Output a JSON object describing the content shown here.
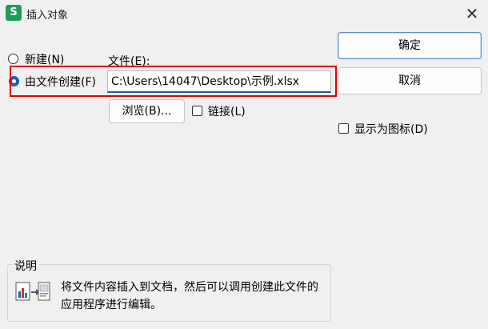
{
  "window": {
    "app_icon": "S",
    "title": "插入对象",
    "close": "✕"
  },
  "options": {
    "new": "新建(N)",
    "from_file": "由文件创建(F)",
    "selected": "from_file"
  },
  "file": {
    "label": "文件(E):",
    "value": "C:\\Users\\14047\\Desktop\\示例.xlsx"
  },
  "buttons": {
    "ok": "确定",
    "cancel": "取消",
    "browse": "浏览(B)..."
  },
  "checkboxes": {
    "link": "链接(L)",
    "link_checked": false,
    "display_as_icon": "显示为图标(D)",
    "display_as_icon_checked": false
  },
  "description": {
    "title": "说明",
    "text": "将文件内容插入到文档，然后可以调用创建此文件的应用程序进行编辑。"
  },
  "colors": {
    "accent": "#1a5fb4",
    "highlight_box": "#e00000",
    "app_icon_bg": "#1f9e5a"
  }
}
